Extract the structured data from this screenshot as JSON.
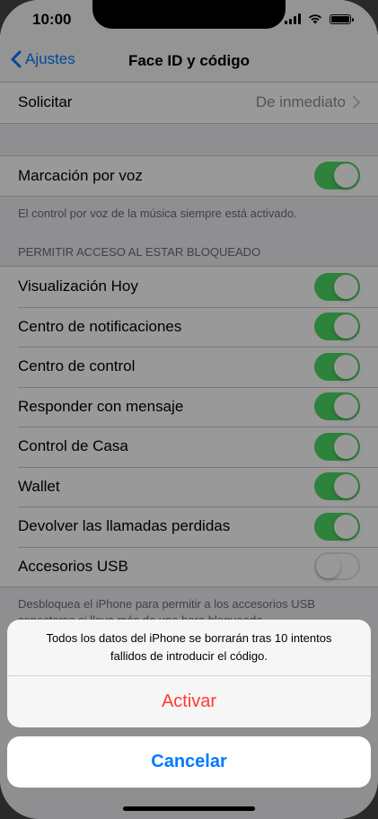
{
  "status": {
    "time": "10:00"
  },
  "nav": {
    "back_label": "Ajustes",
    "title": "Face ID y código"
  },
  "solicitar": {
    "label": "Solicitar",
    "value": "De inmediato"
  },
  "voice": {
    "label": "Marcación por voz",
    "on": true,
    "footer": "El control por voz de la música siempre está activado."
  },
  "lock_access": {
    "header": "PERMITIR ACCESO AL ESTAR BLOQUEADO",
    "items": [
      {
        "label": "Visualización Hoy",
        "on": true
      },
      {
        "label": "Centro de notificaciones",
        "on": true
      },
      {
        "label": "Centro de control",
        "on": true
      },
      {
        "label": "Responder con mensaje",
        "on": true
      },
      {
        "label": "Control de Casa",
        "on": true
      },
      {
        "label": "Wallet",
        "on": true
      },
      {
        "label": "Devolver las llamadas perdidas",
        "on": true
      },
      {
        "label": "Accesorios USB",
        "on": false
      }
    ],
    "footer": "Desbloquea el iPhone para permitir a los accesorios USB conectarse si lleva más de una hora bloqueado."
  },
  "action_sheet": {
    "message": "Todos los datos del iPhone se borrarán tras 10 intentos fallidos de introducir el código.",
    "activate_label": "Activar",
    "cancel_label": "Cancelar"
  },
  "colors": {
    "accent": "#007aff",
    "toggle_on": "#4cd964",
    "destructive": "#ff3b30"
  }
}
